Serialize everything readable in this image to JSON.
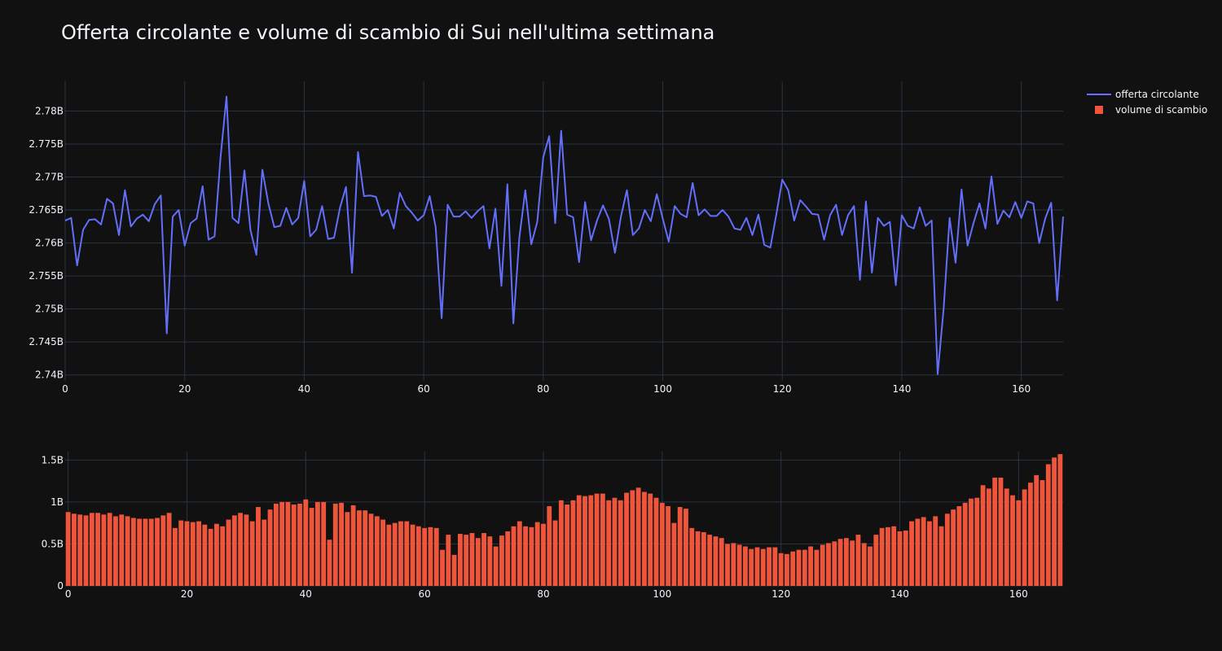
{
  "title": "Offerta circolante e volume di scambio di Sui nell'ultima settimana",
  "colors": {
    "background": "#111111",
    "grid": "#283442",
    "text": "#f2f5fa",
    "line": "#636efa",
    "bar": "#ef553b"
  },
  "legend": {
    "placement": "top-right",
    "items": [
      {
        "label": "offerta circolante",
        "kind": "line"
      },
      {
        "label": "volume di scambio",
        "kind": "bar"
      }
    ]
  },
  "chart_data": [
    {
      "type": "line",
      "series": [
        {
          "name": "offerta circolante",
          "x_start": 0,
          "values": [
            2.7634,
            2.7638,
            2.7566,
            2.762,
            2.7635,
            2.7636,
            2.7628,
            2.7667,
            2.766,
            2.7612,
            2.768,
            2.7625,
            2.7637,
            2.7643,
            2.7633,
            2.7659,
            2.7672,
            2.7463,
            2.764,
            2.765,
            2.7596,
            2.763,
            2.7637,
            2.7686,
            2.7605,
            2.761,
            2.773,
            2.7822,
            2.7638,
            2.763,
            2.771,
            2.762,
            2.7582,
            2.7711,
            2.766,
            2.7624,
            2.7626,
            2.7653,
            2.7628,
            2.7638,
            2.7694,
            2.761,
            2.762,
            2.7656,
            2.7606,
            2.7608,
            2.7654,
            2.7685,
            2.7555,
            2.7738,
            2.7671,
            2.7672,
            2.767,
            2.7641,
            2.765,
            2.7622,
            2.7676,
            2.7656,
            2.7646,
            2.7634,
            2.7642,
            2.7671,
            2.7624,
            2.7486,
            2.7658,
            2.764,
            2.764,
            2.7648,
            2.7638,
            2.7648,
            2.7656,
            2.7592,
            2.7652,
            2.7535,
            2.7689,
            2.7478,
            2.7608,
            2.768,
            2.7598,
            2.7632,
            2.773,
            2.7762,
            2.763,
            2.777,
            2.7643,
            2.7639,
            2.7571,
            2.7662,
            2.7604,
            2.7634,
            2.7657,
            2.7636,
            2.7585,
            2.764,
            2.768,
            2.7612,
            2.7622,
            2.765,
            2.7633,
            2.7674,
            2.7637,
            2.7602,
            2.7656,
            2.7644,
            2.7639,
            2.7691,
            2.7642,
            2.7651,
            2.7641,
            2.7641,
            2.765,
            2.764,
            2.7622,
            2.762,
            2.7638,
            2.7612,
            2.7643,
            2.7597,
            2.7593,
            2.7643,
            2.7696,
            2.768,
            2.7634,
            2.7665,
            2.7655,
            2.7644,
            2.7643,
            2.7605,
            2.7642,
            2.7658,
            2.7612,
            2.7642,
            2.7656,
            2.7544,
            2.7663,
            2.7555,
            2.7638,
            2.7626,
            2.7632,
            2.7536,
            2.7642,
            2.7626,
            2.7622,
            2.7654,
            2.7626,
            2.7634,
            2.7401,
            2.75,
            2.7638,
            2.757,
            2.7681,
            2.7596,
            2.763,
            2.766,
            2.7622,
            2.7701,
            2.7629,
            2.7649,
            2.7639,
            2.7662,
            2.7638,
            2.7663,
            2.766,
            2.76,
            2.7637,
            2.7661,
            2.7513,
            2.764
          ]
        }
      ],
      "xlim": [
        0,
        167
      ],
      "ylim": [
        2.7391,
        2.7845
      ],
      "x_ticks": [
        0,
        20,
        40,
        60,
        80,
        100,
        120,
        140,
        160
      ],
      "x_tick_labels": [
        "0",
        "20",
        "40",
        "60",
        "80",
        "100",
        "120",
        "140",
        "160"
      ],
      "y_ticks": [
        2.74,
        2.745,
        2.75,
        2.755,
        2.76,
        2.765,
        2.77,
        2.775,
        2.78
      ],
      "y_tick_labels": [
        "2.74B",
        "2.745B",
        "2.75B",
        "2.755B",
        "2.76B",
        "2.765B",
        "2.77B",
        "2.775B",
        "2.78B"
      ],
      "grid": true
    },
    {
      "type": "bar",
      "series": [
        {
          "name": "volume di scambio",
          "x_start": 0,
          "values": [
            0.88,
            0.86,
            0.85,
            0.84,
            0.87,
            0.87,
            0.85,
            0.87,
            0.83,
            0.85,
            0.83,
            0.81,
            0.8,
            0.8,
            0.8,
            0.81,
            0.84,
            0.87,
            0.69,
            0.78,
            0.77,
            0.76,
            0.77,
            0.73,
            0.68,
            0.74,
            0.71,
            0.79,
            0.84,
            0.87,
            0.85,
            0.77,
            0.94,
            0.79,
            0.91,
            0.98,
            1.0,
            1.0,
            0.97,
            0.98,
            1.03,
            0.93,
            1.0,
            1.0,
            0.55,
            0.98,
            0.99,
            0.88,
            0.96,
            0.9,
            0.9,
            0.86,
            0.83,
            0.79,
            0.73,
            0.75,
            0.77,
            0.77,
            0.73,
            0.71,
            0.69,
            0.7,
            0.69,
            0.43,
            0.61,
            0.37,
            0.62,
            0.61,
            0.63,
            0.57,
            0.63,
            0.59,
            0.47,
            0.6,
            0.65,
            0.71,
            0.77,
            0.71,
            0.7,
            0.76,
            0.74,
            0.95,
            0.78,
            1.02,
            0.97,
            1.02,
            1.08,
            1.07,
            1.08,
            1.1,
            1.1,
            1.02,
            1.05,
            1.02,
            1.11,
            1.14,
            1.17,
            1.12,
            1.1,
            1.05,
            0.99,
            0.95,
            0.75,
            0.94,
            0.92,
            0.69,
            0.65,
            0.64,
            0.61,
            0.59,
            0.57,
            0.5,
            0.51,
            0.49,
            0.47,
            0.44,
            0.46,
            0.44,
            0.46,
            0.46,
            0.39,
            0.38,
            0.41,
            0.43,
            0.43,
            0.47,
            0.43,
            0.49,
            0.51,
            0.53,
            0.56,
            0.57,
            0.54,
            0.61,
            0.51,
            0.47,
            0.61,
            0.69,
            0.7,
            0.71,
            0.65,
            0.66,
            0.77,
            0.8,
            0.82,
            0.77,
            0.83,
            0.71,
            0.86,
            0.91,
            0.95,
            0.99,
            1.04,
            1.05,
            1.2,
            1.16,
            1.29,
            1.29,
            1.16,
            1.08,
            1.02,
            1.15,
            1.23,
            1.32,
            1.26,
            1.45,
            1.53,
            1.57
          ]
        }
      ],
      "xlim": [
        -0.5,
        167.5
      ],
      "ylim": [
        0,
        1.6
      ],
      "x_ticks": [
        0,
        20,
        40,
        60,
        80,
        100,
        120,
        140,
        160
      ],
      "x_tick_labels": [
        "0",
        "20",
        "40",
        "60",
        "80",
        "100",
        "120",
        "140",
        "160"
      ],
      "y_ticks": [
        0,
        0.5,
        1,
        1.5
      ],
      "y_tick_labels": [
        "0",
        "0.5B",
        "1B",
        "1.5B"
      ],
      "grid": true
    }
  ]
}
